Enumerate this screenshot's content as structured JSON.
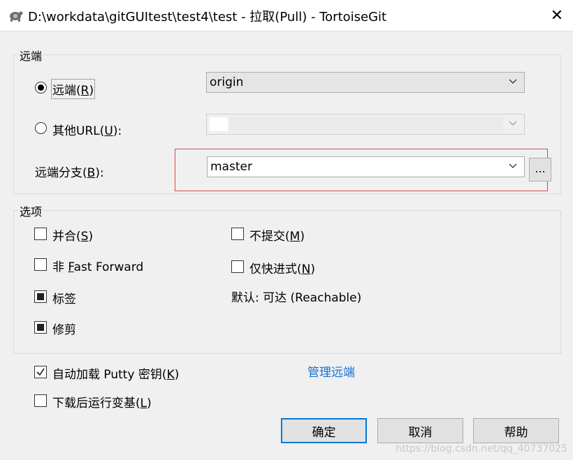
{
  "window": {
    "title": "D:\\workdata\\gitGUItest\\test4\\test - 拉取(Pull) - TortoiseGit",
    "icon": "tortoisegit-icon",
    "close_glyph": "✕"
  },
  "remote_group": {
    "label": "远端",
    "remote_radio": {
      "prefix": "远端(",
      "mnemonic": "R",
      "suffix": ")",
      "checked": true
    },
    "remote_select": {
      "value": "origin"
    },
    "other_url_radio": {
      "prefix": "其他URL(",
      "mnemonic": "U",
      "suffix": "):",
      "checked": false
    },
    "other_url_select": {
      "value": ""
    },
    "remote_branch_label": {
      "prefix": "远端分支(",
      "mnemonic": "B",
      "suffix": "):"
    },
    "remote_branch_select": {
      "value": "master"
    },
    "browse_button": "..."
  },
  "options_group": {
    "label": "选项",
    "merge": {
      "prefix": "并合(",
      "mnemonic": "S",
      "suffix": ")",
      "state": "unchecked"
    },
    "no_ff": {
      "prefix": "非 ",
      "mnemonic": "F",
      "suffix": "ast Forward",
      "state": "unchecked"
    },
    "tags": {
      "label": "标签",
      "state": "indeterminate"
    },
    "prune": {
      "label": "修剪",
      "state": "indeterminate"
    },
    "no_commit": {
      "prefix": "不提交(",
      "mnemonic": "M",
      "suffix": ")",
      "state": "unchecked"
    },
    "ff_only": {
      "prefix": "仅快进式(",
      "mnemonic": "N",
      "suffix": ")",
      "state": "unchecked"
    },
    "default_text": "默认: 可达 (Reachable)"
  },
  "autoload_putty": {
    "prefix": "自动加载 Putty 密钥(",
    "mnemonic": "K",
    "suffix": ")",
    "state": "checked"
  },
  "rebase_after": {
    "prefix": "下载后运行变基(",
    "mnemonic": "L",
    "suffix": ")",
    "state": "unchecked"
  },
  "manage_remotes_link": "管理远端",
  "buttons": {
    "ok": "确定",
    "cancel": "取消",
    "help": "帮助"
  },
  "watermark": "https://blog.csdn.net/qq_40737025",
  "colors": {
    "link": "#1a6fd1",
    "highlight": "#d9484b",
    "default_border": "#0078d7"
  }
}
